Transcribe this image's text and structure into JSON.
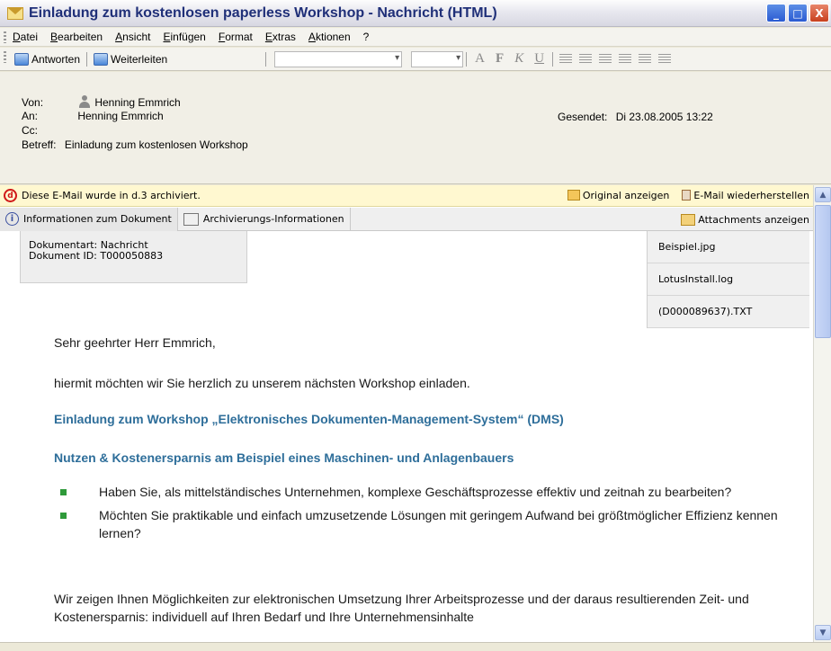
{
  "window": {
    "title": "Einladung zum kostenlosen paperless Workshop - Nachricht (HTML)",
    "buttons": {
      "minimize": "_",
      "maximize": "□",
      "close": "X"
    }
  },
  "menu": [
    "Datei",
    "Bearbeiten",
    "Ansicht",
    "Einfügen",
    "Format",
    "Extras",
    "Aktionen",
    "?"
  ],
  "toolbar": {
    "reply": "Antworten",
    "forward": "Weiterleiten",
    "format_labels": [
      "A",
      "F",
      "K",
      "U"
    ]
  },
  "header": {
    "from_label": "Von:",
    "from_value": "Henning Emmrich",
    "to_label": "An:",
    "to_value": "Henning Emmrich",
    "cc_label": "Cc:",
    "cc_value": "",
    "subject_label": "Betreff:",
    "subject_value": "Einladung zum kostenlosen Workshop",
    "sent_label": "Gesendet:",
    "sent_value": "Di 23.08.2005 13:22"
  },
  "notice": {
    "text": "Diese E-Mail wurde in d.3 archiviert.",
    "original": "Original anzeigen",
    "restore": "E-Mail wiederherstellen"
  },
  "tabs": {
    "info": "Informationen zum Dokument",
    "archive": "Archivierungs-Informationen",
    "attachments": "Attachments anzeigen"
  },
  "docinfo": {
    "type": "Dokumentart: Nachricht",
    "id": "Dokument ID: T000050883"
  },
  "attachments": [
    "Beispiel.jpg",
    "LotusInstall.log",
    "(D000089637).TXT"
  ],
  "body": {
    "greeting": "Sehr geehrter Herr Emmrich,",
    "intro": "hiermit möchten wir Sie herzlich zu unserem nächsten Workshop einladen.",
    "heading1": "Einladung zum Workshop „Elektronisches Dokumenten-Management-System“ (DMS)",
    "heading2": "Nutzen & Kostenersparnis am Beispiel eines Maschinen- und Anlagenbauers",
    "bullets": [
      "Haben Sie, als mittelständisches Unternehmen, komplexe Geschäftsprozesse effektiv und zeitnah zu bearbeiten?",
      "Möchten Sie praktikable und einfach umzusetzende Lösungen mit geringem Aufwand bei größtmöglicher Effizienz kennen lernen?"
    ],
    "closing": "Wir zeigen Ihnen Möglichkeiten zur elektronischen Umsetzung Ihrer Arbeitsprozesse und der daraus resultierenden Zeit- und Kostenersparnis: individuell auf Ihren Bedarf und Ihre Unternehmensinhalte"
  }
}
